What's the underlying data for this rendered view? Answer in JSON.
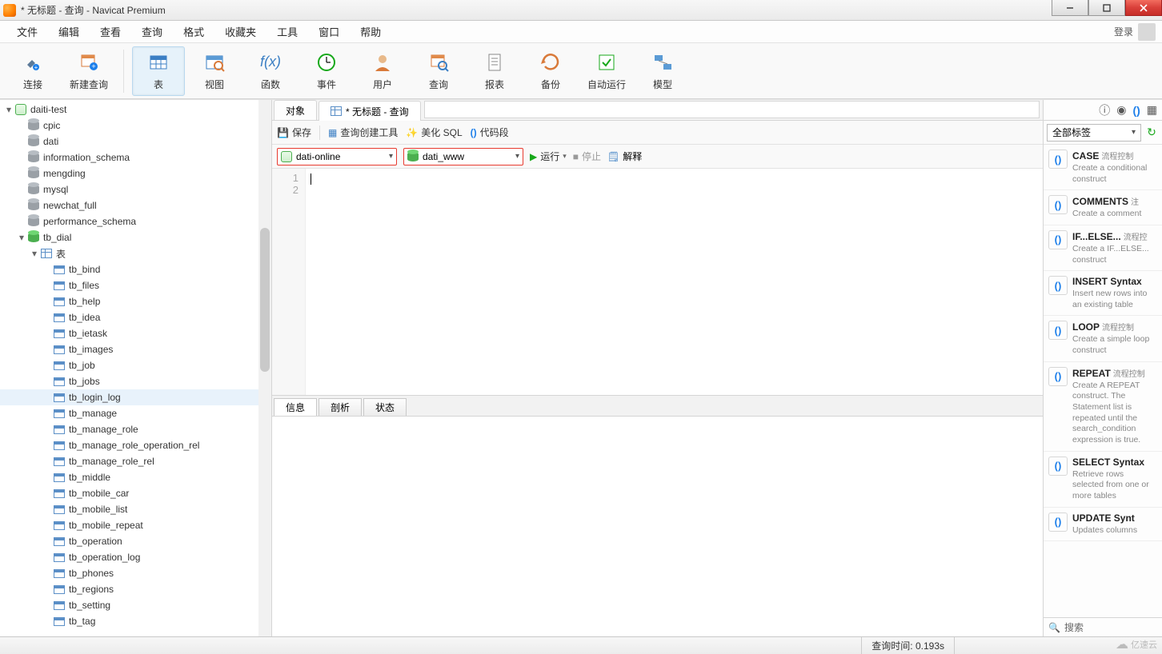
{
  "window": {
    "title": "* 无标题 - 查询 - Navicat Premium"
  },
  "menu": {
    "items": [
      "文件",
      "编辑",
      "查看",
      "查询",
      "格式",
      "收藏夹",
      "工具",
      "窗口",
      "帮助"
    ],
    "login": "登录"
  },
  "toolbar": {
    "items": [
      {
        "label": "连接",
        "icon": "plug"
      },
      {
        "label": "新建查询",
        "icon": "new-query"
      },
      {
        "label": "表",
        "icon": "table",
        "active": true,
        "sep_before": true
      },
      {
        "label": "视图",
        "icon": "view"
      },
      {
        "label": "函数",
        "icon": "fx"
      },
      {
        "label": "事件",
        "icon": "clock"
      },
      {
        "label": "用户",
        "icon": "user"
      },
      {
        "label": "查询",
        "icon": "query"
      },
      {
        "label": "报表",
        "icon": "report"
      },
      {
        "label": "备份",
        "icon": "backup"
      },
      {
        "label": "自动运行",
        "icon": "auto"
      },
      {
        "label": "模型",
        "icon": "model"
      }
    ]
  },
  "tree": {
    "connection": "daiti-test",
    "dbs": [
      "cpic",
      "dati",
      "information_schema",
      "mengding",
      "mysql",
      "newchat_full",
      "performance_schema"
    ],
    "open_db": "tb_dial",
    "tables_label": "表",
    "tables": [
      "tb_bind",
      "tb_files",
      "tb_help",
      "tb_idea",
      "tb_ietask",
      "tb_images",
      "tb_job",
      "tb_jobs",
      "tb_login_log",
      "tb_manage",
      "tb_manage_role",
      "tb_manage_role_operation_rel",
      "tb_manage_role_rel",
      "tb_middle",
      "tb_mobile_car",
      "tb_mobile_list",
      "tb_mobile_repeat",
      "tb_operation",
      "tb_operation_log",
      "tb_phones",
      "tb_regions",
      "tb_setting",
      "tb_tag"
    ],
    "selected": "tb_login_log"
  },
  "center": {
    "tabs": {
      "objects": "对象",
      "query": "* 无标题 - 查询"
    },
    "editor_toolbar": {
      "save": "保存",
      "builder": "查询创建工具",
      "beautify": "美化 SQL",
      "snippet": "代码段"
    },
    "conn_row": {
      "connection": "dati-online",
      "database": "dati_www",
      "run": "运行",
      "stop": "停止",
      "explain": "解释"
    },
    "gutter": [
      "1",
      "2"
    ],
    "info_tabs": [
      "信息",
      "剖析",
      "状态"
    ]
  },
  "right": {
    "tag_filter": "全部标签",
    "snippets": [
      {
        "title": "CASE",
        "cat": "流程控制",
        "desc": "Create a conditional construct"
      },
      {
        "title": "COMMENTS",
        "cat": "注",
        "desc": "Create a comment"
      },
      {
        "title": "IF...ELSE...",
        "cat": "流程控",
        "desc": "Create a IF...ELSE... construct"
      },
      {
        "title": "INSERT Syntax",
        "cat": "",
        "desc": "Insert new rows into an existing table"
      },
      {
        "title": "LOOP",
        "cat": "流程控制",
        "desc": "Create a simple loop construct"
      },
      {
        "title": "REPEAT",
        "cat": "流程控制",
        "desc": "Create A REPEAT construct. The Statement list is repeated until the search_condition expression is true."
      },
      {
        "title": "SELECT Syntax",
        "cat": "",
        "desc": "Retrieve rows selected from one or more tables"
      },
      {
        "title": "UPDATE Synt",
        "cat": "",
        "desc": "Updates columns"
      }
    ],
    "search": "搜索"
  },
  "status": {
    "query_time": "查询时间: 0.193s",
    "watermark": "亿速云"
  }
}
